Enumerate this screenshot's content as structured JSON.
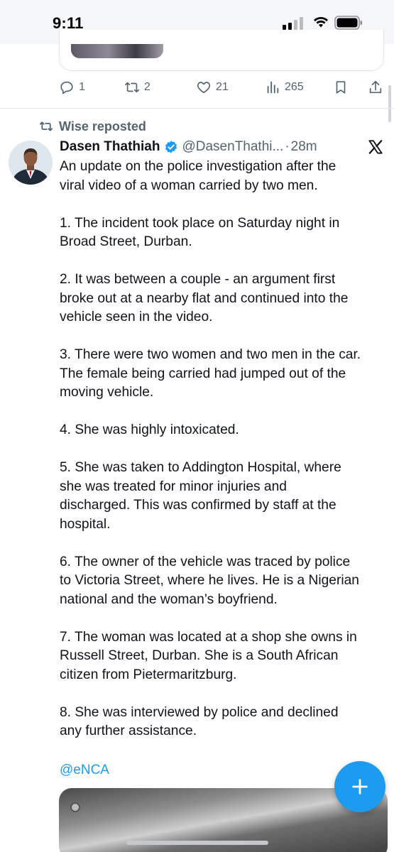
{
  "status_bar": {
    "time": "9:11"
  },
  "previous_tweet": {
    "actions": {
      "replies": "1",
      "reposts": "2",
      "likes": "21",
      "views": "265"
    }
  },
  "tweet": {
    "repost_label": "Wise reposted",
    "author_name": "Dasen Thathiah",
    "handle": "@DasenThathi...",
    "separator": "·",
    "time": "28m",
    "paragraphs": [
      "An update on the police investigation after the\nviral video of a woman carried by two men.",
      "1. The incident took place on Saturday night in\nBroad Street, Durban.",
      "2. It was between a couple - an argument first\nbroke out at a nearby flat and continued into the\nvehicle seen in the video.",
      "3. There were two women and two men in the car.\nThe female being carried had jumped out of the\nmoving vehicle.",
      "4. She was highly intoxicated.",
      "5. She was taken to Addington Hospital, where\nshe was treated for minor injuries and\ndischarged. This was confirmed by staff at the\nhospital.",
      "6. The owner of the vehicle was traced by police\nto Victoria Street, where he lives. He is a Nigerian\nnational and the woman’s boyfriend.",
      "7. The woman was located at a shop she owns in\nRussell Street, Durban. She is a South African\ncitizen from Pietermaritzburg.",
      "8. She was interviewed by police and declined\nany further assistance."
    ],
    "mention": "@eNCA"
  },
  "icons": {
    "reply": "reply-icon",
    "repost": "repost-icon",
    "like": "heart-icon",
    "views": "views-icon",
    "bookmark": "bookmark-icon",
    "share": "share-icon",
    "verified": "verified-badge-icon",
    "x_logo": "x-logo-icon",
    "compose": "plus-icon"
  },
  "colors": {
    "accent": "#1d9bf0",
    "muted": "#536471",
    "text": "#0f1419"
  }
}
